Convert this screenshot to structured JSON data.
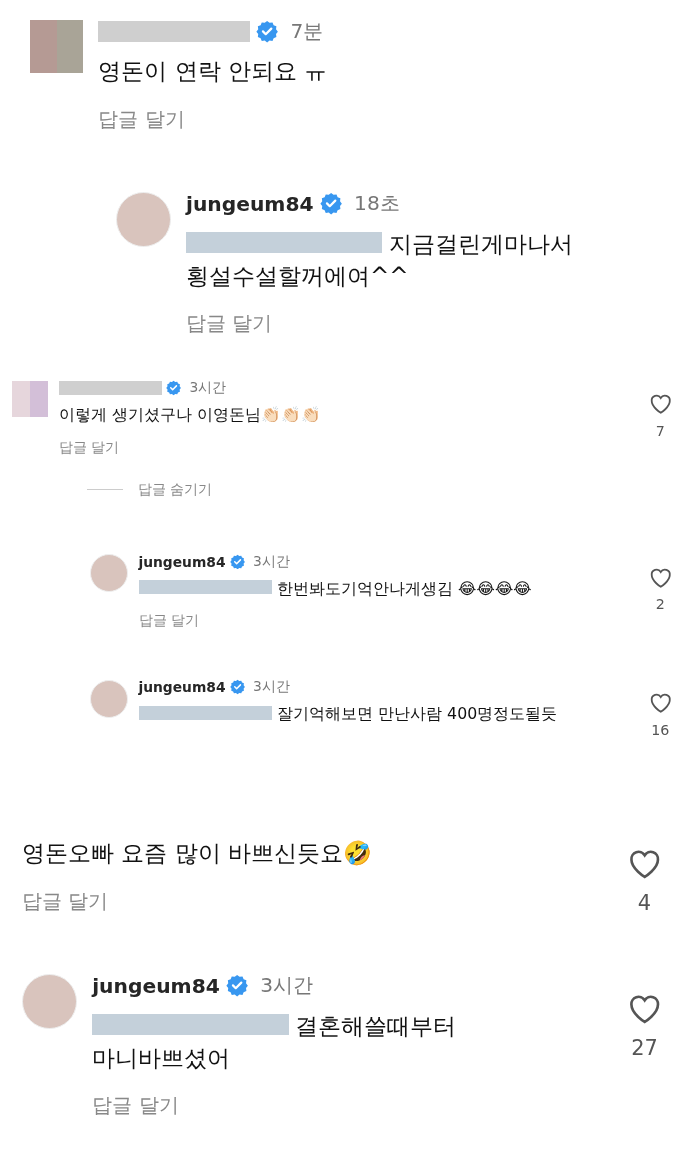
{
  "panels": [
    {
      "kind": "large",
      "comments": [
        {
          "author_hidden": true,
          "verified": true,
          "time": "7분",
          "text": "영돈이 연락 안되요 ㅠ",
          "reply_label": "답글 달기",
          "children": [
            {
              "author": "jungeum84",
              "verified": true,
              "time": "18초",
              "mention_hidden": true,
              "text": "지금걸린게마나서 횡설수설할꺼에여^^",
              "reply_label": "답글 달기"
            }
          ]
        }
      ]
    },
    {
      "kind": "small",
      "comments": [
        {
          "author_hidden": true,
          "verified": true,
          "time": "3시간",
          "text": "이렇게 생기셨구나 이영돈님👏🏻👏🏻👏🏻",
          "reply_label": "답글 달기",
          "likes": "7",
          "hide_replies_label": "답글 숨기기",
          "children": [
            {
              "author": "jungeum84",
              "verified": true,
              "time": "3시간",
              "mention_hidden": true,
              "text": "한번봐도기억안나게생김 😂😂😂😂",
              "reply_label": "답글 달기",
              "likes": "2"
            },
            {
              "author": "jungeum84",
              "verified": true,
              "time": "3시간",
              "mention_hidden": true,
              "text": "잘기억해보면 만난사람 400명정도될듯",
              "likes": "16"
            }
          ]
        }
      ]
    },
    {
      "kind": "large",
      "comments": [
        {
          "text": "영돈오빠 요즘 많이 바쁘신듯요🤣",
          "reply_label": "답글 달기",
          "likes": "4",
          "children": [
            {
              "author": "jungeum84",
              "verified": true,
              "time": "3시간",
              "mention_hidden": true,
              "text": "결혼해쓸때부터 마니바쁘셨어",
              "reply_label": "답글 달기",
              "likes": "27"
            }
          ]
        }
      ]
    }
  ]
}
